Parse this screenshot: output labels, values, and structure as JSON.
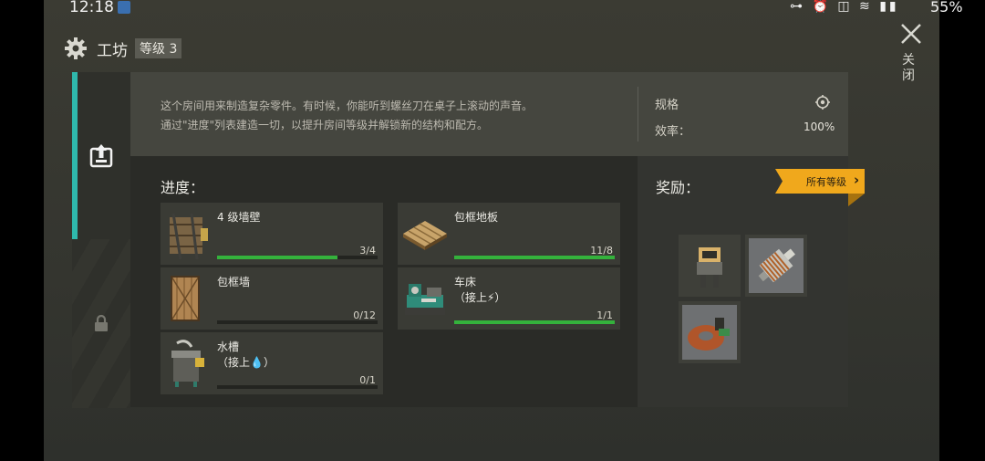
{
  "status_bar": {
    "time": "12:18",
    "icons": "⊶ ⏰ ◫ ≋ ▮▮",
    "battery": "55%"
  },
  "header": {
    "title": "工坊",
    "level_badge": "等级 3",
    "close_label": "关闭"
  },
  "description": {
    "line1": "这个房间用来制造复杂零件。有时候，你能听到螺丝刀在桌子上滚动的声音。",
    "line2": "通过\"进度\"列表建造一切，以提升房间等级并解锁新的结构和配方。"
  },
  "specs": {
    "label": "规格",
    "efficiency_label": "效率：",
    "efficiency_value": "100%"
  },
  "progress": {
    "title": "进度：",
    "items": [
      {
        "name": "4 级墙壁",
        "count": "3/4",
        "fraction": 0.75,
        "icon": "wall-icon"
      },
      {
        "name": "包框地板",
        "count": "11/8",
        "fraction": 1.0,
        "icon": "floor-icon"
      },
      {
        "name": "包框墙",
        "count": "0/12",
        "fraction": 0.0,
        "icon": "framed-wall-icon"
      },
      {
        "name": "车床\n（接上⚡）",
        "count": "1/1",
        "fraction": 1.0,
        "icon": "lathe-icon"
      },
      {
        "name": "水槽\n（接上💧）",
        "count": "0/1",
        "fraction": 0.0,
        "icon": "sink-icon"
      }
    ]
  },
  "rewards": {
    "title": "奖励：",
    "all_levels": "所有等级",
    "items": [
      "workbench-icon",
      "drill-motor-icon",
      "coil-icon"
    ]
  },
  "colors": {
    "accent": "#2fb8ac",
    "progress_fill": "#34b23c",
    "ribbon": "#f0a81c"
  }
}
